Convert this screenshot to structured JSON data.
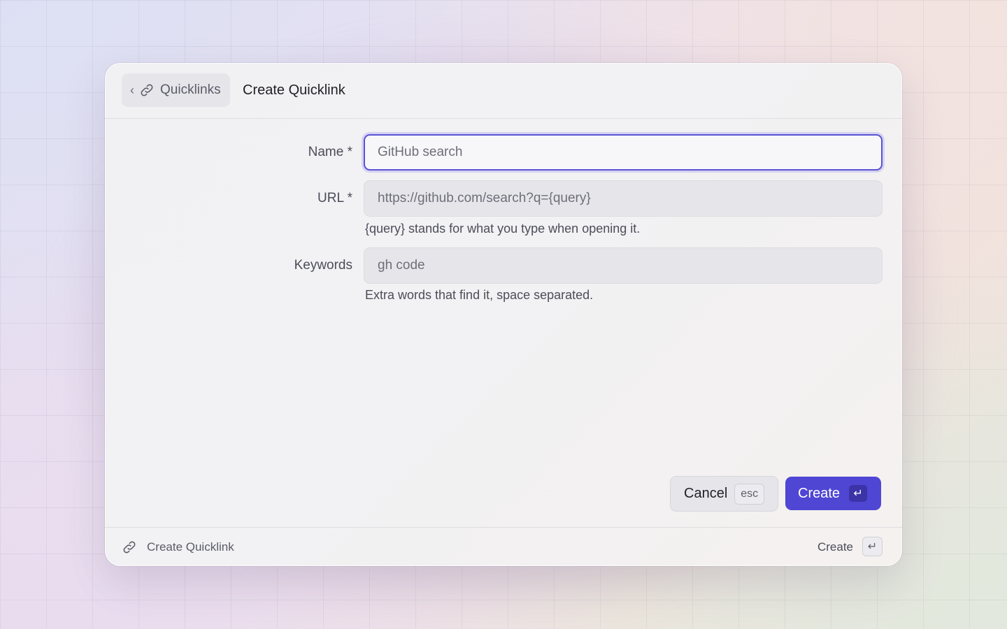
{
  "header": {
    "back_label": "Quicklinks",
    "back_chevron": "‹",
    "title": "Create Quicklink"
  },
  "form": {
    "name": {
      "label": "Name *",
      "placeholder": "GitHub search",
      "value": ""
    },
    "url": {
      "label": "URL *",
      "placeholder": "https://github.com/search?q={query}",
      "value": "",
      "hint": "{query} stands for what you type when opening it."
    },
    "keywords": {
      "label": "Keywords",
      "placeholder": "gh code",
      "value": "",
      "hint": "Extra words that find it, space separated."
    }
  },
  "actions": {
    "cancel_label": "Cancel",
    "cancel_key": "esc",
    "create_label": "Create",
    "create_key": "↵"
  },
  "footer": {
    "title": "Create Quicklink",
    "action_label": "Create",
    "action_key": "↵"
  },
  "icons": {
    "back": "chevron-left-icon",
    "link": "link-icon",
    "enter": "enter-key-icon"
  },
  "colors": {
    "accent": "#4f46d4",
    "focus_ring": "#5b53d6",
    "text_primary": "#1f1f26",
    "text_secondary": "#4d4d5a"
  }
}
